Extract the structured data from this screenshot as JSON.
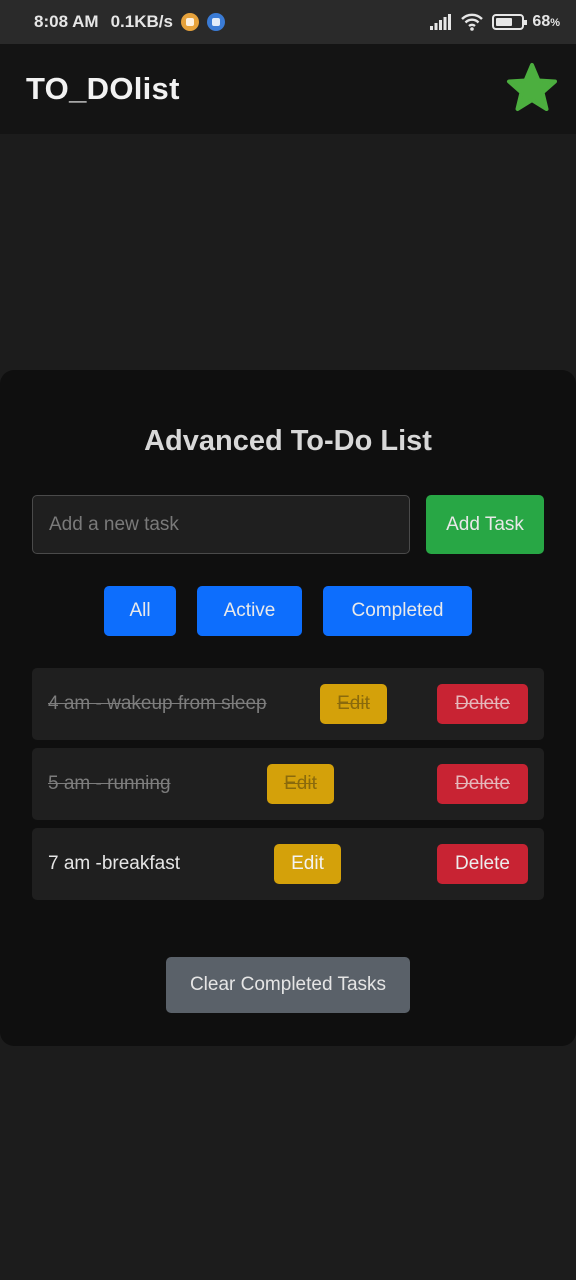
{
  "status_bar": {
    "time": "8:08 AM",
    "speed": "0.1KB/s",
    "battery_percent": "68",
    "battery_level": 0.68
  },
  "app_bar": {
    "title": "TO_DOlist",
    "star_color": "#4caf3f"
  },
  "todo": {
    "title": "Advanced To-Do List",
    "input_placeholder": "Add a new task",
    "input_value": "",
    "add_label": "Add Task",
    "filters": [
      "All",
      "Active",
      "Completed"
    ],
    "tasks": [
      {
        "text": "4 am - wakeup from sleep",
        "completed": true,
        "edit_label": "Edit",
        "delete_label": "Delete"
      },
      {
        "text": "5 am - running",
        "completed": true,
        "edit_label": "Edit",
        "delete_label": "Delete"
      },
      {
        "text": "7 am -breakfast",
        "completed": false,
        "edit_label": "Edit",
        "delete_label": "Delete"
      }
    ],
    "clear_label": "Clear Completed Tasks"
  },
  "colors": {
    "add": "#28a745",
    "filter": "#0d6efd",
    "edit": "#d4a10a",
    "delete": "#c82333",
    "clear": "#5a6169"
  }
}
